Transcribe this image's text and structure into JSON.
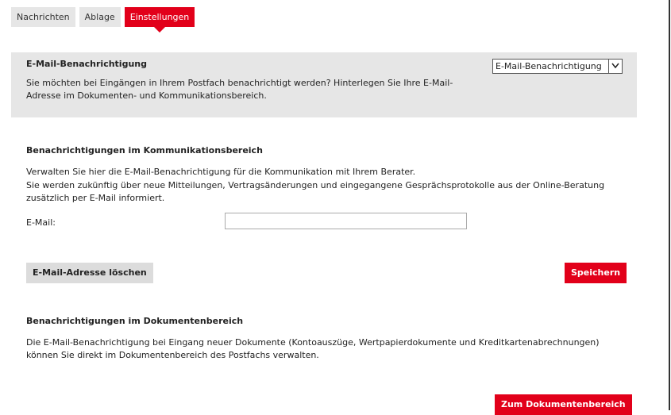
{
  "tabs": [
    {
      "label": "Nachrichten",
      "active": false
    },
    {
      "label": "Ablage",
      "active": false
    },
    {
      "label": "Einstellungen",
      "active": true
    }
  ],
  "notification_box": {
    "title": "E-Mail-Benachrichtigung",
    "text": "Sie möchten bei Eingängen in Ihrem Postfach benachrichtigt werden? Hinterlegen Sie Ihre E-Mail-Adresse im Dokumenten- und Kommunikationsbereich.",
    "select_value": "E-Mail-Benachrichtigung"
  },
  "communication": {
    "title": "Benachrichtigungen im Kommunikationsbereich",
    "line1": "Verwalten Sie hier die E-Mail-Benachrichtigung für die Kommunikation mit Ihrem Berater.",
    "line2": "Sie werden zukünftig über neue Mitteilungen, Vertragsänderungen und eingegangene Gesprächsprotokolle aus der Online-Beratung zusätzlich per E-Mail informiert.",
    "email_label": "E-Mail:",
    "email_value": "",
    "delete_button": "E-Mail-Adresse löschen",
    "save_button": "Speichern"
  },
  "documents": {
    "title": "Benachrichtigungen im Dokumentenbereich",
    "text": "Die E-Mail-Benachrichtigung bei Eingang neuer Dokumente (Kontoauszüge, Wertpapierdokumente und Kreditkartenabrechnungen) können Sie direkt im Dokumentenbereich des Postfachs verwalten.",
    "button": "Zum Dokumentenbereich"
  },
  "colors": {
    "accent": "#e2001a",
    "panel": "#e6e6e6"
  }
}
